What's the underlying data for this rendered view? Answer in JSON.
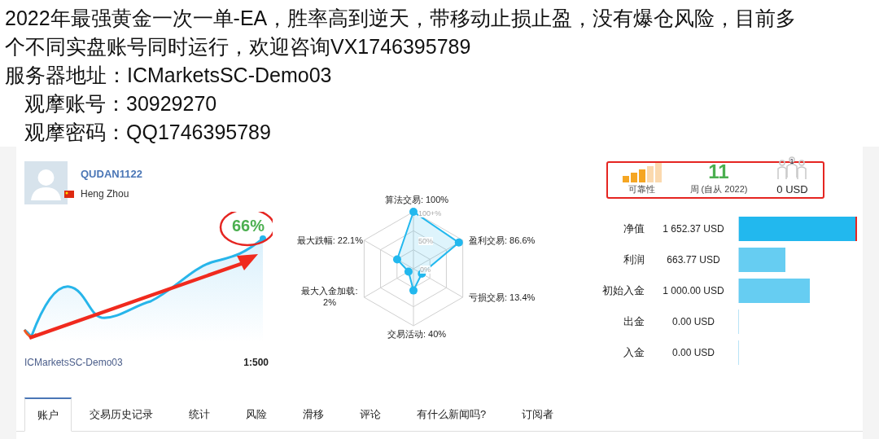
{
  "post": {
    "paragraph": "2022年最强黄金一次一单-EA，胜率高到逆天，带移动止损止盈，没有爆仓风险，目前多个不同实盘账号同时运行，欢迎咨询VX1746395789",
    "server": "服务器地址：ICMarketsSC-Demo03",
    "account": "观摩账号：30929270",
    "password": "观摩密码：QQ1746395789"
  },
  "profile": {
    "name": "QUDAN1122",
    "location": "Heng Zhou",
    "gain": "66%",
    "server": "ICMarketsSC-Demo03",
    "leverage": "1:500"
  },
  "radar": {
    "ticks": [
      "100+%",
      "50%",
      "0%"
    ],
    "axes": [
      "算法交易: 100%",
      "最大跌幅: 22.1%",
      "盈利交易: 86.6%",
      "最大入金加载: 2%",
      "亏损交易: 13.4%",
      "交易活动: 40%"
    ]
  },
  "summary": {
    "reliability": {
      "label": "可靠性"
    },
    "weeks": {
      "value": "11",
      "label": "周 (自从 2022)"
    },
    "subscribers": {
      "count": "1",
      "value": "0 USD"
    }
  },
  "stats": [
    {
      "label": "净值",
      "value": "1 652.37 USD",
      "level": 1.0,
      "color": "#22b8ee"
    },
    {
      "label": "利润",
      "value": "663.77 USD",
      "level": 0.39,
      "color": "#66cdf2"
    },
    {
      "label": "初始入金",
      "value": "1 000.00 USD",
      "level": 0.6,
      "color": "#66cdf2"
    },
    {
      "label": "出金",
      "value": "0.00 USD"
    },
    {
      "label": "入金",
      "value": "0.00 USD"
    }
  ],
  "tabs": [
    {
      "label": "账户",
      "selected": true
    },
    {
      "label": "交易历史记录",
      "selected": false
    },
    {
      "label": "统计",
      "selected": false
    },
    {
      "label": "风险",
      "selected": false
    },
    {
      "label": "滑移",
      "selected": false
    },
    {
      "label": "评论",
      "selected": false
    },
    {
      "label": "有什么新闻吗?",
      "selected": false
    },
    {
      "label": "订阅者",
      "selected": false
    }
  ]
}
